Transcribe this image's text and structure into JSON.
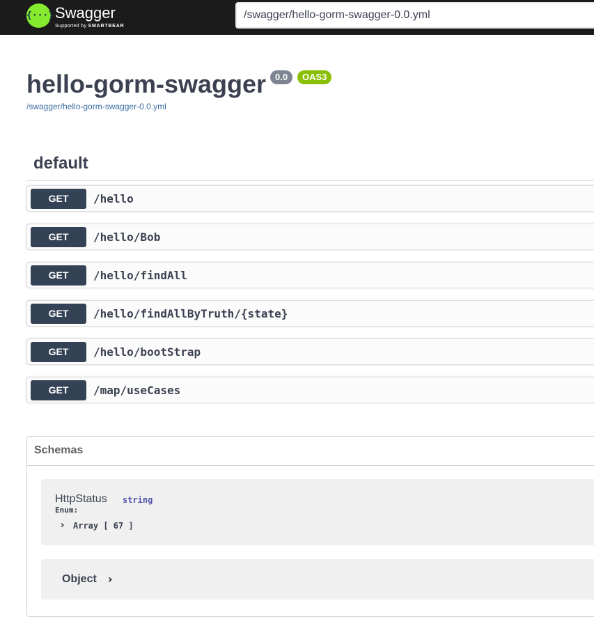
{
  "topbar": {
    "logo_glyph": "{···}",
    "logo_text": "Swagger",
    "logo_sub_prefix": "Supported by",
    "logo_sub_brand": "SMARTBEAR",
    "url_value": "/swagger/hello-gorm-swagger-0.0.yml"
  },
  "info": {
    "title": "hello-gorm-swagger",
    "version_badge": "0.0",
    "oas_badge": "OAS3",
    "spec_link": "/swagger/hello-gorm-swagger-0.0.yml"
  },
  "tag": {
    "name": "default"
  },
  "operations": [
    {
      "method": "GET",
      "path": "/hello"
    },
    {
      "method": "GET",
      "path": "/hello/Bob"
    },
    {
      "method": "GET",
      "path": "/hello/findAll"
    },
    {
      "method": "GET",
      "path": "/hello/findAllByTruth/{state}"
    },
    {
      "method": "GET",
      "path": "/hello/bootStrap"
    },
    {
      "method": "GET",
      "path": "/map/useCases"
    }
  ],
  "schemas": {
    "title": "Schemas",
    "models": [
      {
        "name": "HttpStatus",
        "type": "string",
        "enum_label": "Enum:",
        "enum_value": "Array [ 67 ]"
      },
      {
        "name": "Object"
      }
    ]
  },
  "colors": {
    "topbar_bg": "#1b1b1b",
    "logo_green": "#85ea2d",
    "get_method_bg": "#344256",
    "version_badge_bg": "#7d8492",
    "oas_badge_bg": "#89bf04"
  },
  "icons": [
    "swagger-logo-icon",
    "chevron-right-icon"
  ]
}
